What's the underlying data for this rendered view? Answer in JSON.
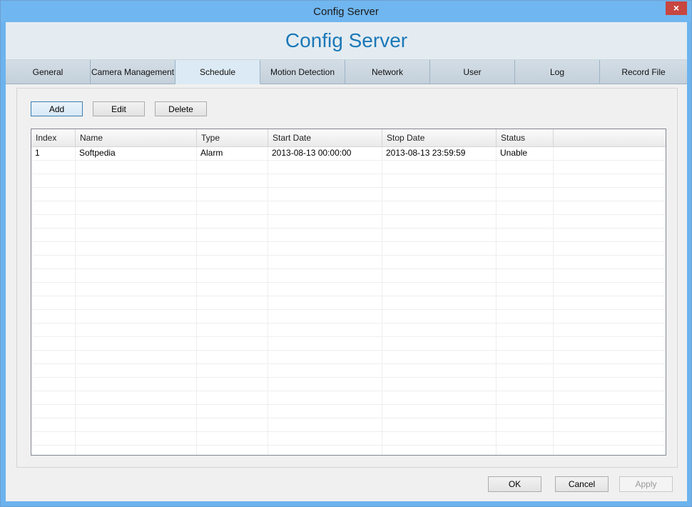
{
  "window": {
    "title": "Config Server",
    "close_glyph": "×"
  },
  "banner": {
    "heading": "Config Server"
  },
  "tabs": [
    {
      "label": "General"
    },
    {
      "label": "Camera Management"
    },
    {
      "label": "Schedule"
    },
    {
      "label": "Motion Detection"
    },
    {
      "label": "Network"
    },
    {
      "label": "User"
    },
    {
      "label": "Log"
    },
    {
      "label": "Record File"
    }
  ],
  "active_tab": "Schedule",
  "toolbar": {
    "add_label": "Add",
    "edit_label": "Edit",
    "delete_label": "Delete"
  },
  "schedule_table": {
    "columns": [
      "Index",
      "Name",
      "Type",
      "Start Date",
      "Stop Date",
      "Status"
    ],
    "rows": [
      [
        "1",
        "Softpedia",
        "Alarm",
        "2013-08-13 00:00:00",
        "2013-08-13 23:59:59",
        "Unable"
      ]
    ]
  },
  "footer": {
    "ok_label": "OK",
    "cancel_label": "Cancel",
    "apply_label": "Apply"
  }
}
